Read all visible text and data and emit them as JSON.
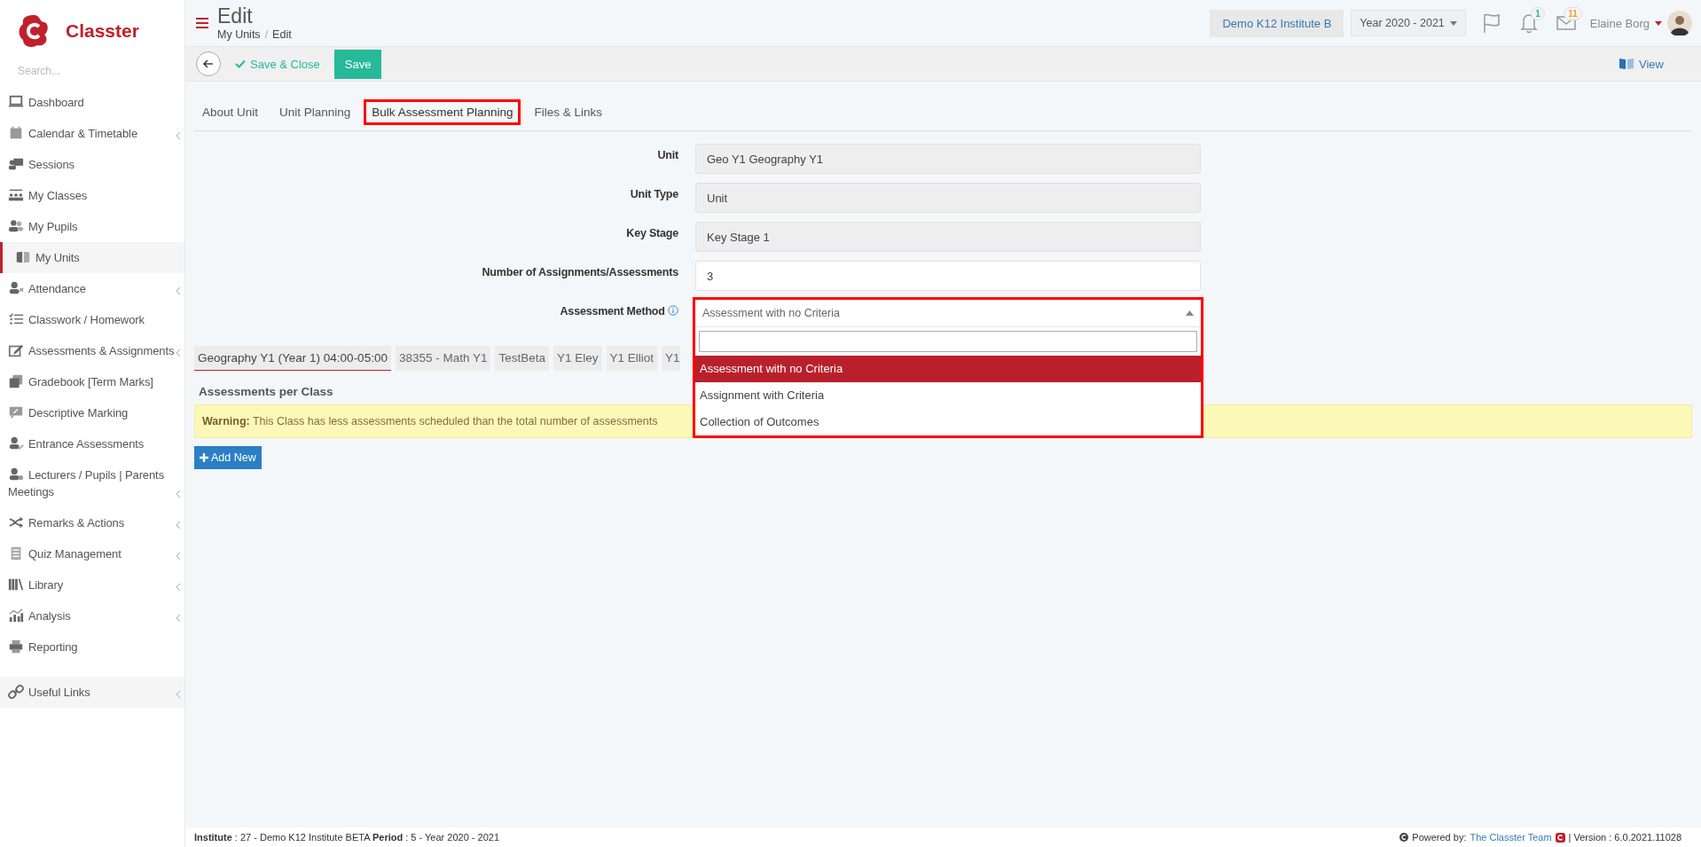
{
  "brand": {
    "name": "Classter"
  },
  "sidebar": {
    "search_placeholder": "Search...",
    "items": [
      {
        "label": "Dashboard",
        "selected": false,
        "has_submenu": false
      },
      {
        "label": "Calendar & Timetable",
        "selected": false,
        "has_submenu": true
      },
      {
        "label": "Sessions",
        "selected": false,
        "has_submenu": false
      },
      {
        "label": "My Classes",
        "selected": false,
        "has_submenu": false
      },
      {
        "label": "My Pupils",
        "selected": false,
        "has_submenu": false
      },
      {
        "label": "My Units",
        "selected": true,
        "has_submenu": false
      },
      {
        "label": "Attendance",
        "selected": false,
        "has_submenu": true
      },
      {
        "label": "Classwork / Homework",
        "selected": false,
        "has_submenu": false
      },
      {
        "label": "Assessments & Assignments",
        "selected": false,
        "has_submenu": true
      },
      {
        "label": "Gradebook [Term Marks]",
        "selected": false,
        "has_submenu": false
      },
      {
        "label": "Descriptive Marking",
        "selected": false,
        "has_submenu": false
      },
      {
        "label": "Entrance Assessments",
        "selected": false,
        "has_submenu": false
      },
      {
        "label": "Lecturers / Pupils | Parents Meetings",
        "selected": false,
        "has_submenu": true
      },
      {
        "label": "Remarks & Actions",
        "selected": false,
        "has_submenu": true
      },
      {
        "label": "Quiz Management",
        "selected": false,
        "has_submenu": true
      },
      {
        "label": "Library",
        "selected": false,
        "has_submenu": true
      },
      {
        "label": "Analysis",
        "selected": false,
        "has_submenu": true
      },
      {
        "label": "Reporting",
        "selected": false,
        "has_submenu": false
      }
    ],
    "bottom_items": [
      {
        "label": "Useful Links",
        "selected": false,
        "has_submenu": true
      }
    ]
  },
  "header": {
    "title": "Edit",
    "breadcrumb": [
      "My Units",
      "Edit"
    ],
    "breadcrumb_separator": "/",
    "institute": "Demo K12 Institute B",
    "year": "Year 2020 - 2021",
    "notifications": "1",
    "messages": "11",
    "user": "Elaine Borg"
  },
  "toolbar": {
    "save_close": "Save & Close",
    "save": "Save",
    "view": "View"
  },
  "tabs": [
    {
      "label": "About Unit",
      "selected": false,
      "highlighted": false
    },
    {
      "label": "Unit Planning",
      "selected": false,
      "highlighted": false
    },
    {
      "label": "Bulk Assessment Planning",
      "selected": true,
      "highlighted": true
    },
    {
      "label": "Files & Links",
      "selected": false,
      "highlighted": false
    }
  ],
  "form": {
    "fields": [
      {
        "label": "Unit",
        "value": "Geo Y1 Geography Y1",
        "kind": "readonly"
      },
      {
        "label": "Unit Type",
        "value": "Unit",
        "kind": "readonly"
      },
      {
        "label": "Key Stage",
        "value": "Key Stage 1",
        "kind": "readonly"
      },
      {
        "label": "Number of Assignments/Assessments",
        "value": "3",
        "kind": "input"
      }
    ],
    "assessment_method": {
      "label": "Assessment Method",
      "value": "Assessment with no Criteria",
      "expanded": true,
      "highlighted": true,
      "options": [
        {
          "label": "Assessment with no Criteria",
          "selected": true
        },
        {
          "label": "Assignment with Criteria",
          "selected": false
        },
        {
          "label": "Collection of Outcomes",
          "selected": false
        }
      ]
    }
  },
  "class_tabs": [
    {
      "label": "Geography Y1 (Year 1) 04:00-05:00",
      "selected": true
    },
    {
      "label": "38355 - Math Y1",
      "selected": false
    },
    {
      "label": "TestBeta",
      "selected": false
    },
    {
      "label": "Y1 Eley",
      "selected": false
    },
    {
      "label": "Y1 Elliot",
      "selected": false
    },
    {
      "label": "Y1",
      "selected": false
    }
  ],
  "section_title": "Assessments per Class",
  "warning": "**Warning:** This Class has less assessments scheduled than the total number of assessments",
  "add_button": "Add New",
  "footer": {
    "info": "**Institute** : 27 - Demo K12 Institute BETA **Period** : 5 - Year 2020 - 2021",
    "powered_by": "Powered by:",
    "team_link": "The Classter Team",
    "version": "| Version : 6.0.2021.11028"
  }
}
